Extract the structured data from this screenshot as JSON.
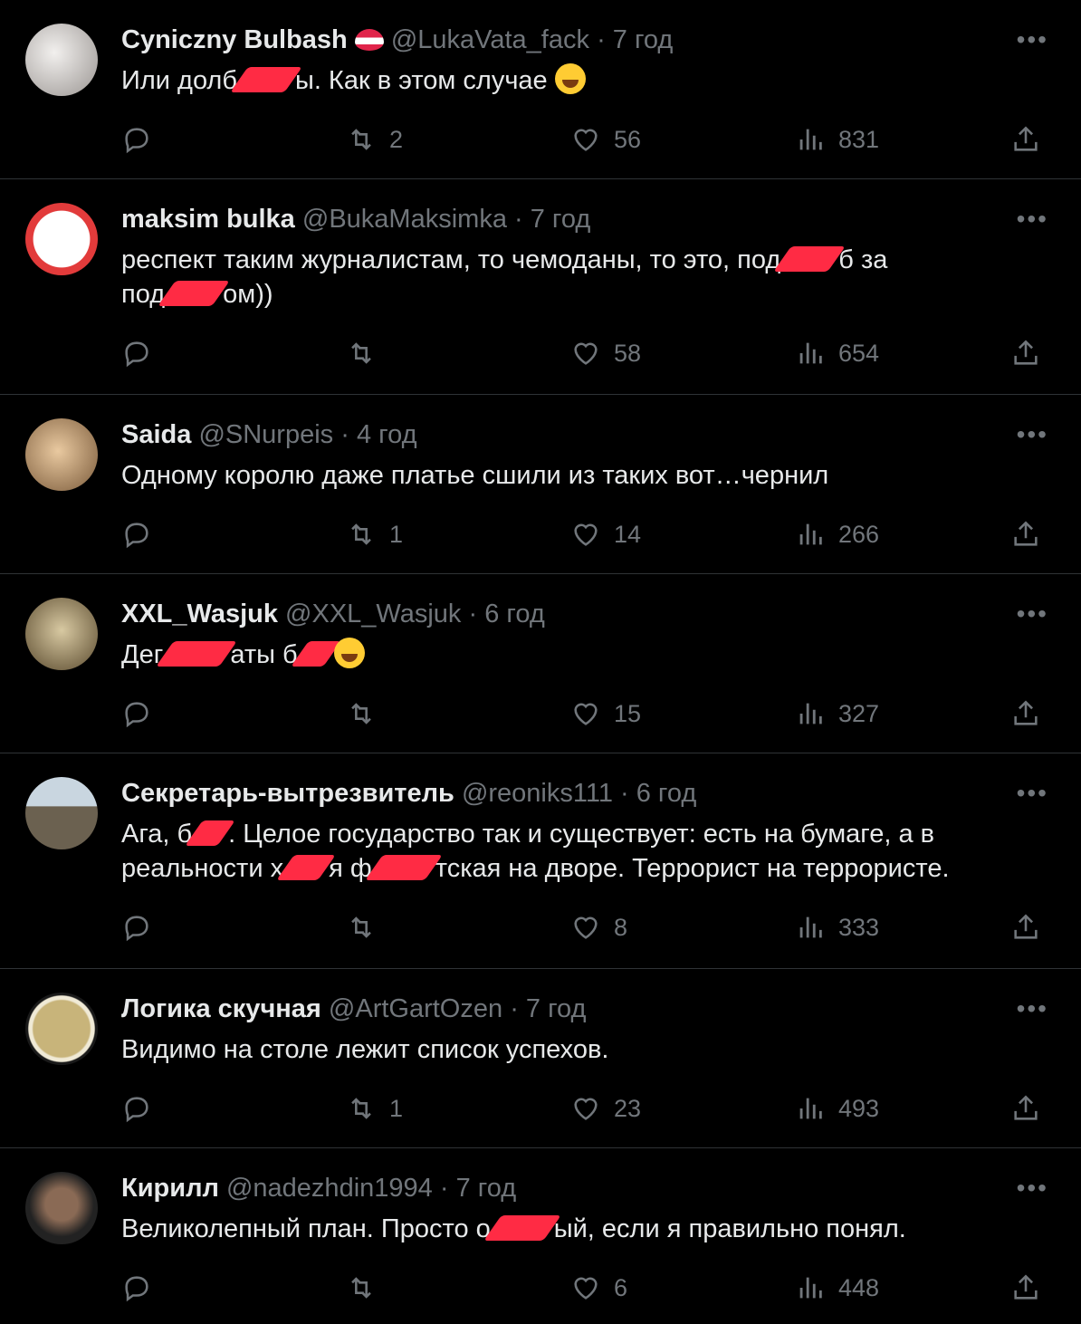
{
  "tweets": [
    {
      "name": "Cyniczny Bulbash",
      "handle": "@LukaVata_fack",
      "dot": "·",
      "time": "7 год",
      "text_a": "Или долб",
      "text_b": "ы. Как в этом случае",
      "text_c": "",
      "text_d": "",
      "replies": "",
      "retweets": "2",
      "likes": "56",
      "views": "831",
      "avatar_color": "#cfcac6"
    },
    {
      "name": "maksim bulka",
      "handle": "@BukaMaksimka",
      "dot": "·",
      "time": "7 год",
      "text_a": "респект таким журналистам, то чемоданы, то это, под",
      "text_b": "б за",
      "text_c": "под",
      "text_d": "ом))",
      "replies": "",
      "retweets": "",
      "likes": "58",
      "views": "654",
      "avatar_color": "#ffffff"
    },
    {
      "name": "Saida",
      "handle": "@SNurpeis",
      "dot": "·",
      "time": "4 год",
      "text_a": "Одному королю даже платье сшили из таких вот…чернил",
      "text_b": "",
      "text_c": "",
      "text_d": "",
      "replies": "",
      "retweets": "1",
      "likes": "14",
      "views": "266",
      "avatar_color": "#b48a5a"
    },
    {
      "name": "XXL_Wasjuk",
      "handle": "@XXL_Wasjuk",
      "dot": "·",
      "time": "6 год",
      "text_a": "Дег",
      "text_b": "аты б",
      "text_c": "",
      "text_d": "",
      "replies": "",
      "retweets": "",
      "likes": "15",
      "views": "327",
      "avatar_color": "#8a7a55"
    },
    {
      "name": "Секретарь-вытрезвитель",
      "handle": "@reoniks111",
      "dot": "·",
      "time": "6 год",
      "text_a": "Ага, б",
      "text_b": ". Целое государство так и существует: есть на бумаге, а в",
      "text_c": "реальности х",
      "text_d": "я ф",
      "text_e": "тская на дворе. Террорист на террористе.",
      "replies": "",
      "retweets": "",
      "likes": "8",
      "views": "333",
      "avatar_color": "#6b6a5e"
    },
    {
      "name": "Логика скучная",
      "handle": "@ArtGartOzen",
      "dot": "·",
      "time": "7 год",
      "text_a": "Видимо на столе лежит список успехов.",
      "text_b": "",
      "text_c": "",
      "text_d": "",
      "replies": "",
      "retweets": "1",
      "likes": "23",
      "views": "493",
      "avatar_color": "#b7a36a"
    },
    {
      "name": "Кирилл",
      "handle": "@nadezhdin1994",
      "dot": "·",
      "time": "7 год",
      "text_a": "Великолепный план. Просто о",
      "text_b": "ый, если я правильно понял.",
      "text_c": "",
      "text_d": "",
      "replies": "",
      "retweets": "",
      "likes": "6",
      "views": "448",
      "avatar_color": "#2a2a2a"
    }
  ],
  "icons": {
    "reply": "reply-icon",
    "retweet": "retweet-icon",
    "like": "heart-icon",
    "views": "views-icon",
    "share": "share-icon",
    "more": "more-icon"
  },
  "colors": {
    "background": "#000000",
    "text": "#e7e9ea",
    "muted": "#71767b",
    "divider": "#2f3336",
    "censor": "#ff2b44"
  }
}
